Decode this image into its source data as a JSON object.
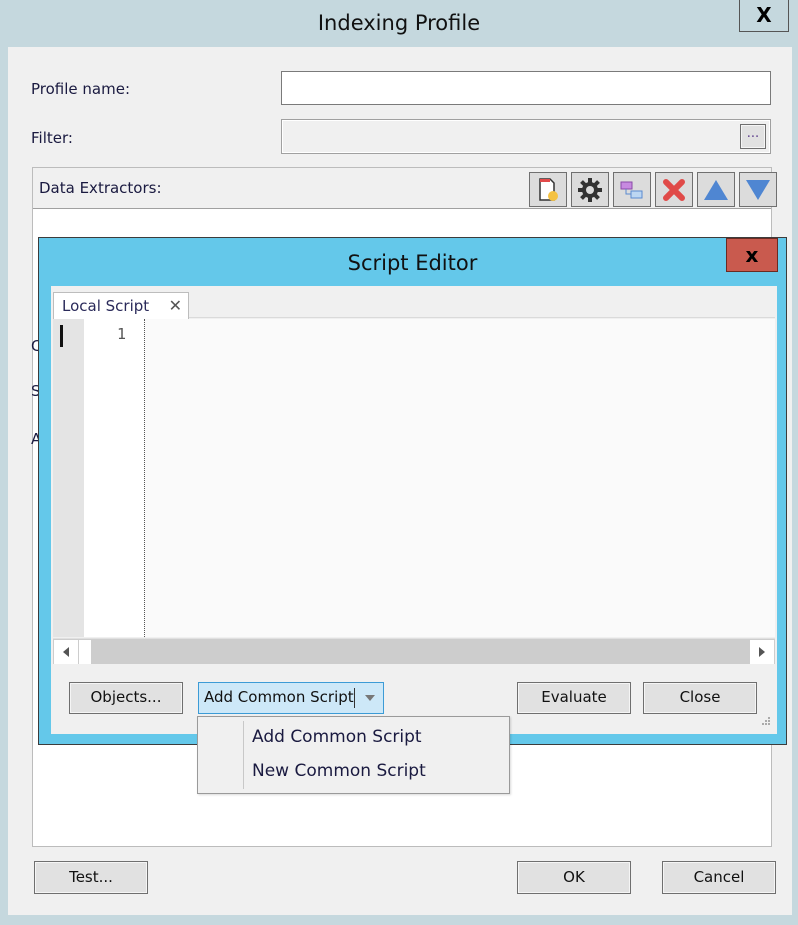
{
  "outer_window": {
    "title": "Indexing Profile",
    "close_glyph": "X",
    "profile_name_label": "Profile name:",
    "profile_name_value": "",
    "filter_label": "Filter:",
    "filter_value": "",
    "filter_browse_label": "...",
    "data_extractors_label": "Data Extractors:",
    "toolbar_icons": [
      "new-document-icon",
      "gear-icon",
      "hierarchy-icon",
      "delete-icon",
      "move-up-icon",
      "move-down-icon"
    ],
    "partial_labels": [
      "C",
      "S",
      "A"
    ],
    "test_button": "Test...",
    "ok_button": "OK",
    "cancel_button": "Cancel"
  },
  "script_editor": {
    "title": "Script Editor",
    "close_glyph": "x",
    "tab_label": "Local Script",
    "tab_close_glyph": "✕",
    "line_numbers": [
      "1"
    ],
    "code": "",
    "objects_button": "Objects...",
    "add_common_script_button": "Add Common Script",
    "evaluate_button": "Evaluate",
    "close_button": "Close"
  },
  "dropdown_menu": {
    "items": [
      "Add Common Script",
      "New Common Script"
    ]
  },
  "colors": {
    "outer_frame": "#c5d8de",
    "editor_frame": "#64c8ea",
    "editor_close": "#c95a4e",
    "split_button_bg": "#cde8f8",
    "split_button_border": "#3c9bd6"
  }
}
